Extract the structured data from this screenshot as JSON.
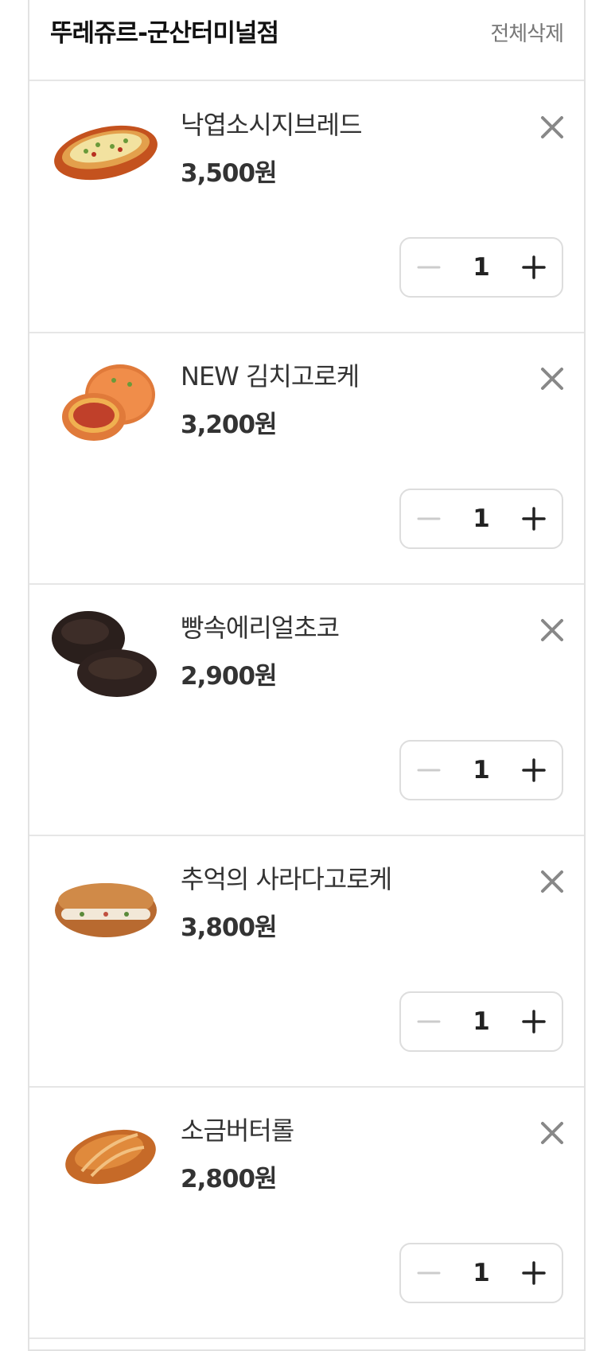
{
  "store": {
    "name": "뚜레쥬르-군산터미널점",
    "delete_all_label": "전체삭제"
  },
  "items": [
    {
      "name": "낙엽소시지브레드",
      "price": "3,500원",
      "quantity": "1",
      "image": "sausage-bread-image"
    },
    {
      "name": "NEW 김치고로케",
      "price": "3,200원",
      "quantity": "1",
      "image": "kimchi-croquette-image"
    },
    {
      "name": "빵속에리얼초코",
      "price": "2,900원",
      "quantity": "1",
      "image": "chocolate-bread-image"
    },
    {
      "name": "추억의 사라다고로케",
      "price": "3,800원",
      "quantity": "1",
      "image": "salad-croquette-image"
    },
    {
      "name": "소금버터롤",
      "price": "2,800원",
      "quantity": "1",
      "image": "salt-butter-roll-image"
    }
  ],
  "icons": {
    "remove": "close-icon",
    "decrement": "minus-icon",
    "increment": "plus-icon"
  },
  "colors": {
    "border": "#e2e2e2",
    "text": "#333333",
    "muted": "#777777",
    "disabled_minus": "#cccccc"
  }
}
